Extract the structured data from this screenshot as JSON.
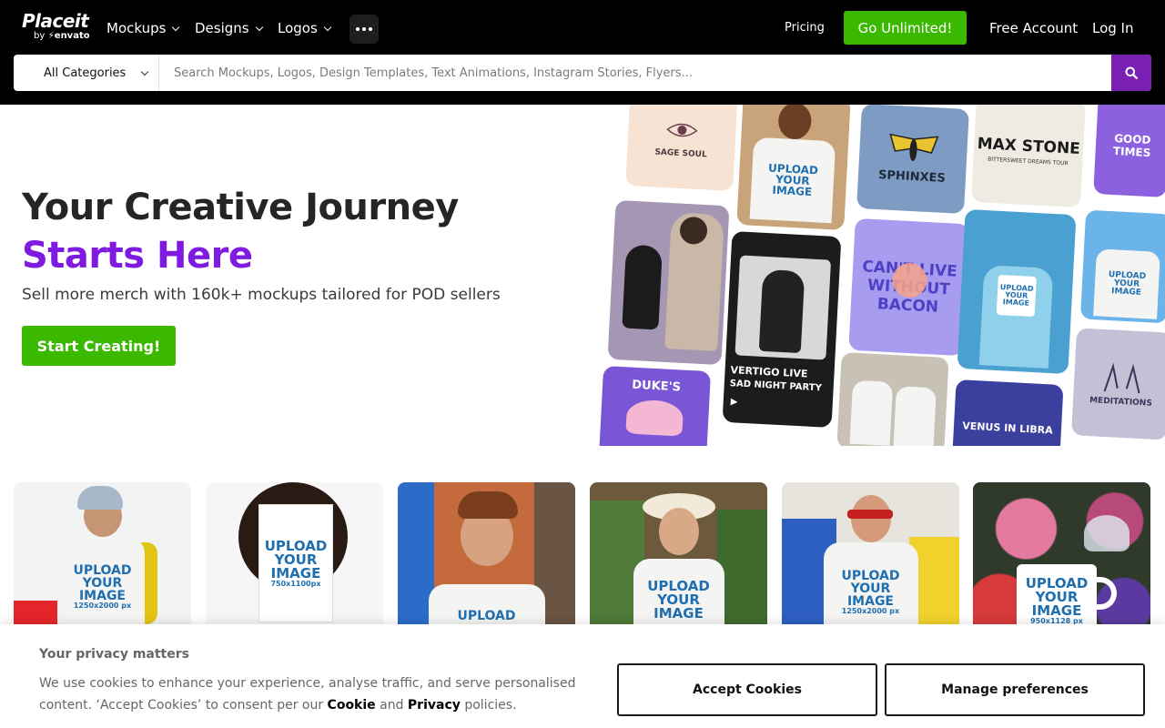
{
  "header": {
    "logo_main": "Placeit",
    "logo_by": "by",
    "logo_brand": "envato",
    "nav": [
      {
        "label": "Mockups"
      },
      {
        "label": "Designs"
      },
      {
        "label": "Logos"
      }
    ],
    "more_icon": "ellipsis-icon",
    "pricing_label": "Pricing",
    "go_unlimited_label": "Go Unlimited!",
    "free_account_label": "Free Account",
    "login_label": "Log In",
    "accent_green": "#3bb800"
  },
  "search": {
    "category_label": "All Categories",
    "placeholder": "Search Mockups, Logos, Design Templates, Text Animations, Instagram Stories, Flyers...",
    "value": "",
    "button_icon": "search-icon",
    "button_color": "#7a1fb3"
  },
  "hero": {
    "title_part1": "Your Creative Journey ",
    "title_accent": "Starts Here",
    "subtitle": "Sell more merch with 160k+ mockups tailored for POD sellers",
    "cta_label": "Start Creating!",
    "accent_purple": "#7f1be0"
  },
  "collage": {
    "sage_soul": "SAGE SOUL",
    "sphinxes": "SPHINXES",
    "max_stone": "MAX STONE",
    "max_stone_sub": "BITTERSWEET DREAMS TOUR",
    "good_times": "GOOD TIMES",
    "cant_live": "CAN'T LIVE WITHOUT BACON",
    "vertigo": "VERTIGO LIVE",
    "sad_night": "SAD NIGHT PARTY",
    "dukes": "DUKE'S",
    "venus": "VENUS IN LIBRA",
    "meditations": "MEDITATIONS",
    "upload_line1": "UPLOAD",
    "upload_line2": "YOUR",
    "upload_line3": "IMAGE",
    "size_shirt": "1250x2000 px",
    "size_book": "750x1100px",
    "size_mug": "950x1128 px"
  },
  "cookie": {
    "title": "Your privacy matters",
    "text_before": "We use cookies to enhance your experience, analyse traffic, and serve personalised content. ‘Accept Cookies’ to consent per our ",
    "cookie_link": "Cookie",
    "and": " and ",
    "privacy_link": "Privacy",
    "text_after": " policies.",
    "accept_label": "Accept Cookies",
    "manage_label": "Manage preferences"
  }
}
